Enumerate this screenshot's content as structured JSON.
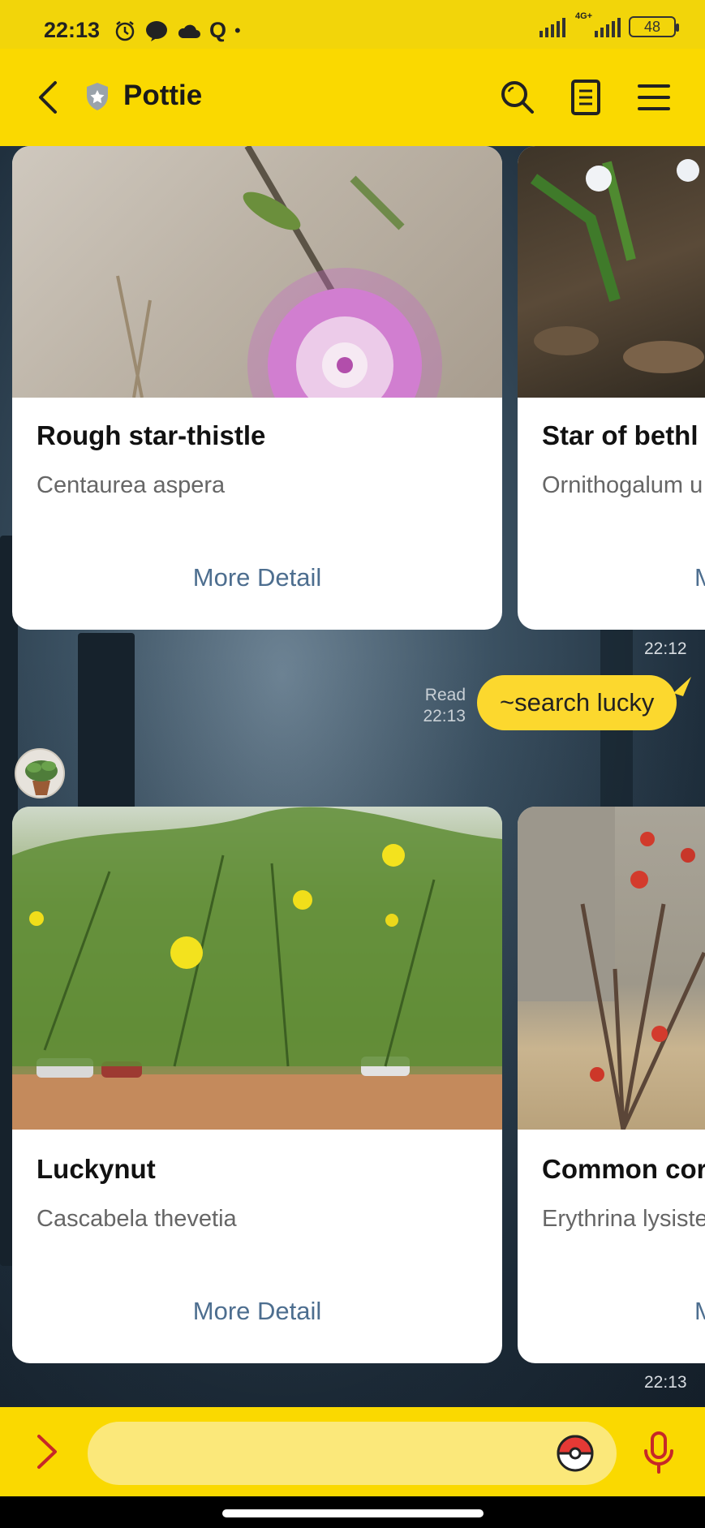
{
  "status_bar": {
    "time": "22:13",
    "network_label": "4G+",
    "battery": "48"
  },
  "header": {
    "title": "Pottie",
    "icons": [
      "back-arrow-icon",
      "shield-icon",
      "search-icon",
      "notes-icon",
      "menu-icon"
    ]
  },
  "messages": {
    "first_carousel": [
      {
        "title": "Rough star-thistle",
        "subtitle": "Centaurea aspera",
        "button": "More Detail"
      },
      {
        "title": "Star of bethl",
        "subtitle": "Ornithogalum u",
        "button": "M"
      }
    ],
    "first_carousel_time": "22:12",
    "user_message": {
      "text": "~search lucky",
      "read_label": "Read",
      "time": "22:13"
    },
    "second_carousel": [
      {
        "title": "Luckynut",
        "subtitle": "Cascabela thevetia",
        "button": "More Detail"
      },
      {
        "title": "Common cor",
        "subtitle": "Erythrina lysiste",
        "button": "M"
      }
    ],
    "second_carousel_time": "22:13"
  },
  "input_bar": {
    "placeholder": "",
    "icons": [
      "expand-arrow-icon",
      "pokeball-icon",
      "microphone-icon"
    ]
  },
  "colors": {
    "header_yellow": "#fad900",
    "bubble_yellow": "#fcd82e",
    "link_blue": "#4d6e8f",
    "input_red": "#c62828"
  }
}
